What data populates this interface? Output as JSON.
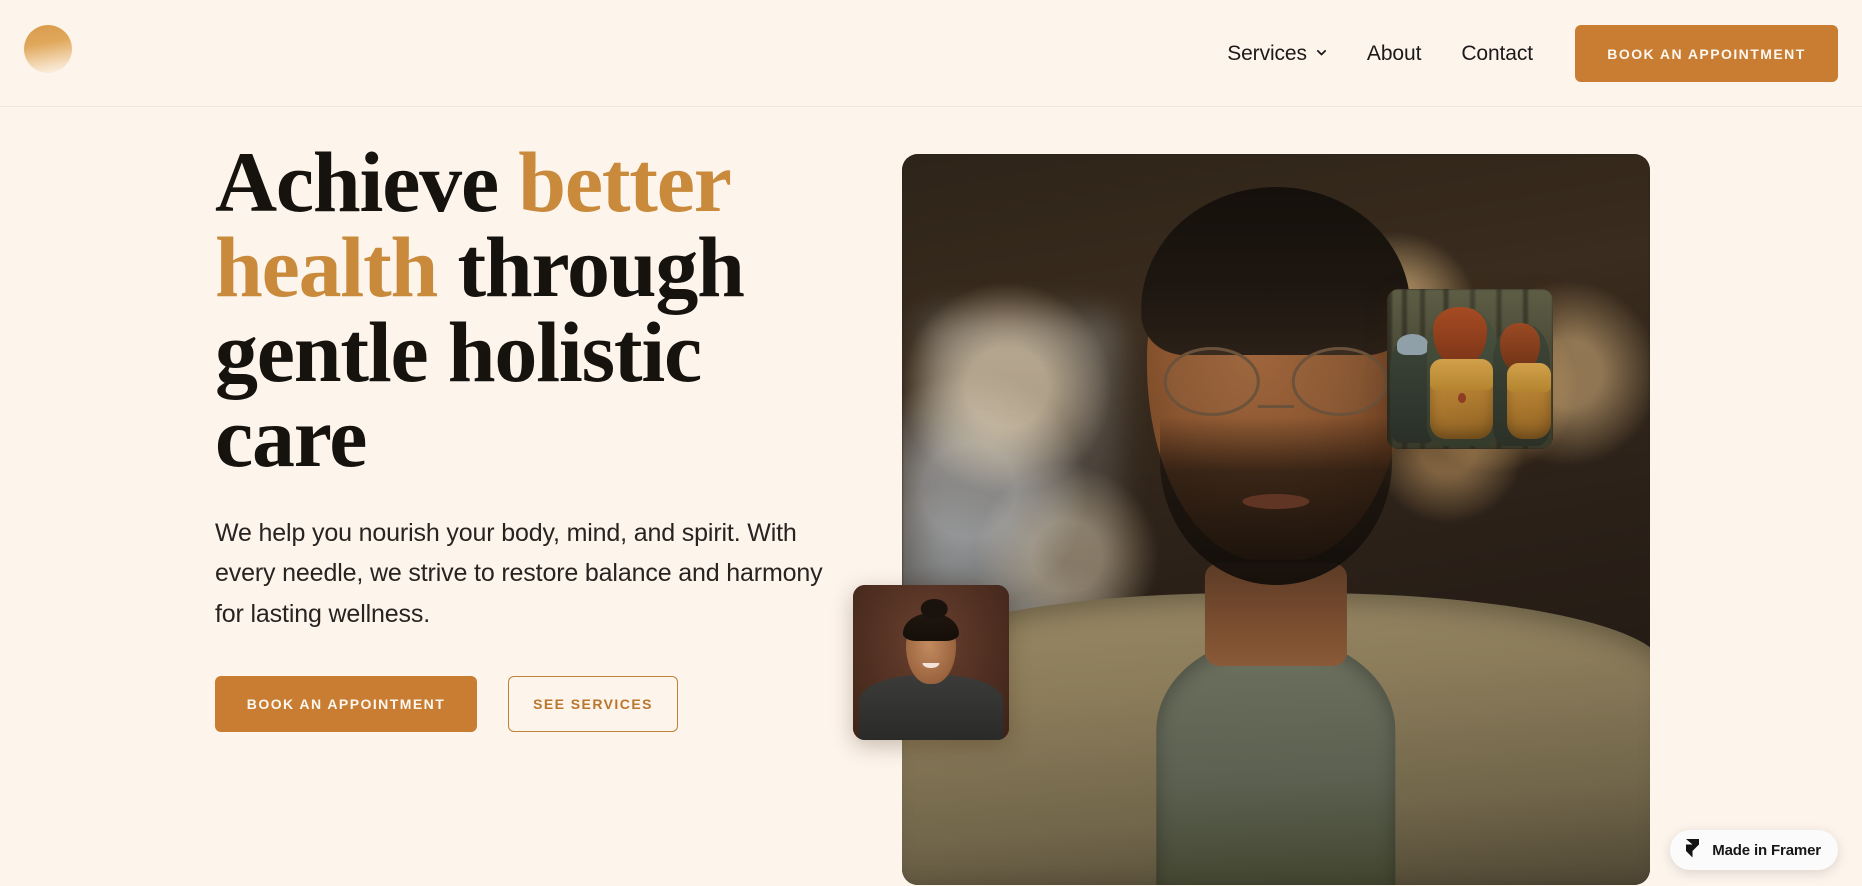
{
  "brand": {
    "logo_icon": "circle-gradient-logo",
    "accent_color": "#C87D32",
    "headline_accent_color": "#C98A3C",
    "background_color": "#FDF4EC"
  },
  "header": {
    "nav": [
      {
        "label": "Services",
        "has_dropdown": true,
        "icon": "chevron-down-icon"
      },
      {
        "label": "About",
        "has_dropdown": false
      },
      {
        "label": "Contact",
        "has_dropdown": false
      }
    ],
    "cta_label": "BOOK AN APPOINTMENT"
  },
  "hero": {
    "headline": {
      "line1_plain": "Achieve ",
      "line1_accent": "better",
      "line2_accent": "health",
      "line2_plain": " through",
      "line3_plain": "gentle holistic care"
    },
    "subcopy": "We help you nourish your body, mind, and spirit. With every needle, we strive to restore balance and harmony for lasting wellness.",
    "primary_cta_label": "BOOK AN APPOINTMENT",
    "secondary_cta_label": "SEE SERVICES",
    "images": [
      {
        "name": "main-portrait",
        "alt": "Man with glasses and beard in a warmly lit cafe"
      },
      {
        "name": "hikers-thumbnail",
        "alt": "Three hikers with backpacks walking in a forest"
      },
      {
        "name": "woman-portrait-thumbnail",
        "alt": "Smiling woman with hair in a bun against a brown backdrop"
      }
    ]
  },
  "badge": {
    "label": "Made in Framer",
    "icon": "framer-logo-icon"
  }
}
